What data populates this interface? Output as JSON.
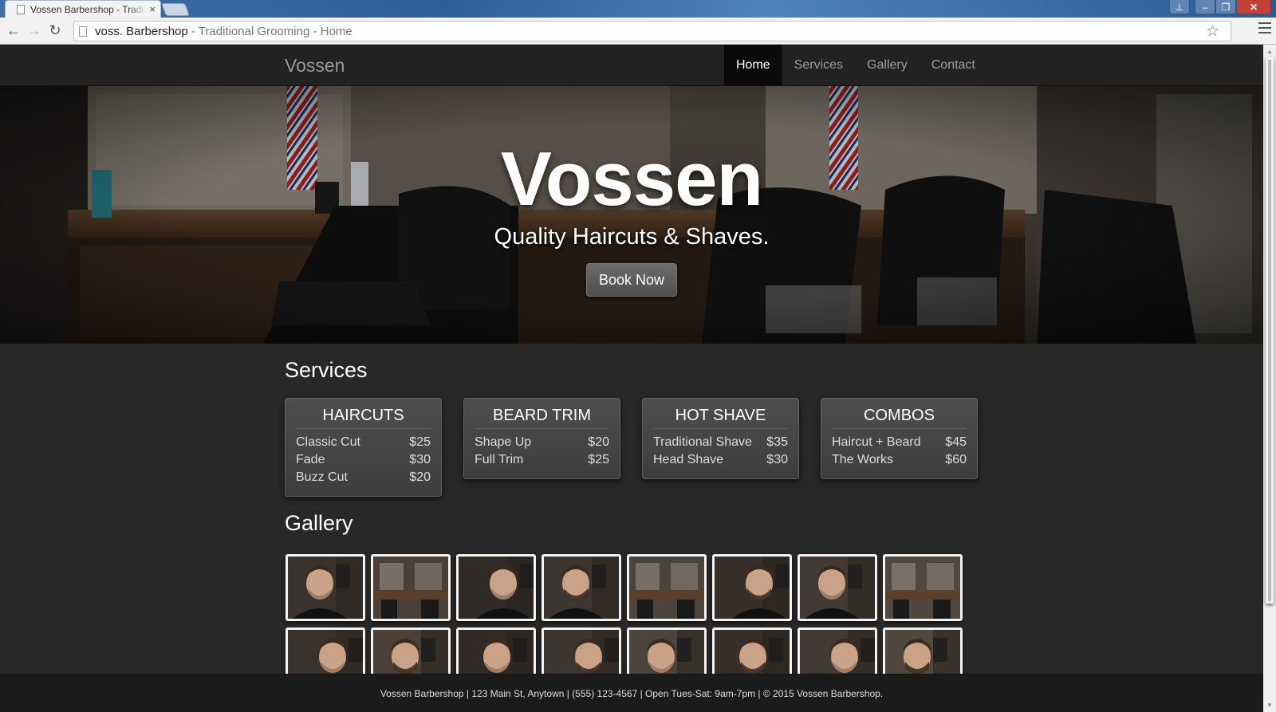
{
  "browser": {
    "tab_title": "Vossen Barbershop - Traditional Grooming - Home",
    "tab_close": "×",
    "address_host": "voss. Barbershop",
    "address_rest": " - Traditional Grooming - Home",
    "back_icon": "←",
    "forward_icon": "→",
    "reload_icon": "↻",
    "star_icon": "☆"
  },
  "nav": {
    "brand": "Vossen",
    "links": [
      "Home",
      "Services",
      "Gallery",
      "Contact"
    ],
    "active": "Home"
  },
  "hero": {
    "title": "Vossen",
    "subtitle": "Quality Haircuts & Shaves.",
    "cta": "Book Now"
  },
  "services": {
    "heading": "Services",
    "cards": [
      {
        "title": "HAIRCUTS",
        "items": [
          {
            "name": "Classic Cut",
            "price": "$25"
          },
          {
            "name": "Fade",
            "price": "$30"
          },
          {
            "name": "Buzz Cut",
            "price": "$20"
          }
        ]
      },
      {
        "title": "BEARD TRIM",
        "items": [
          {
            "name": "Shape Up",
            "price": "$20"
          },
          {
            "name": "Full Trim",
            "price": "$25"
          }
        ]
      },
      {
        "title": "HOT SHAVE",
        "items": [
          {
            "name": "Traditional Shave",
            "price": "$35"
          },
          {
            "name": "Head Shave",
            "price": "$30"
          }
        ]
      },
      {
        "title": "COMBOS",
        "items": [
          {
            "name": "Haircut + Beard",
            "price": "$45"
          },
          {
            "name": "The Works",
            "price": "$60"
          }
        ]
      }
    ]
  },
  "gallery": {
    "heading": "Gallery",
    "rows": 2,
    "per_row": 8
  },
  "footer": {
    "text": "Vossen Barbershop | 123 Main St, Anytown | (555) 123-4567 | Open Tues-Sat: 9am-7pm | © 2015 Vossen Barbershop."
  },
  "colors": {
    "page_bg": "#282828",
    "navbar_bg": "#222222",
    "card_bg": "#464646",
    "accent_text": "#ffffff"
  }
}
